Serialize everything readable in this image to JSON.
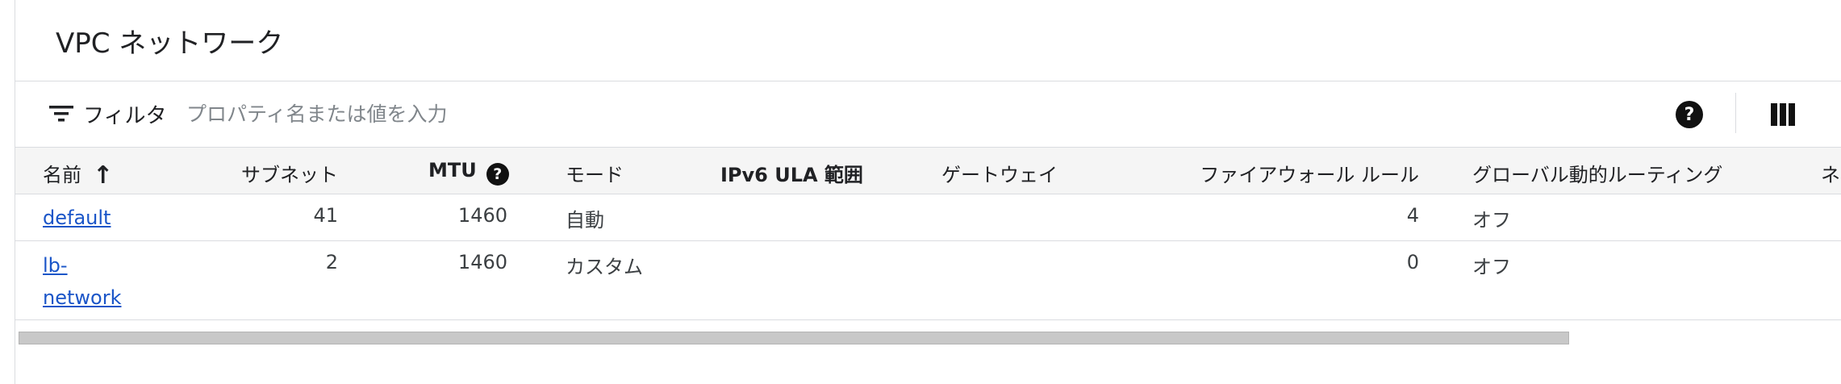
{
  "page": {
    "title": "VPC ネットワーク"
  },
  "filter": {
    "label": "フィルタ",
    "placeholder": "プロパティ名または値を入力",
    "icons": {
      "filter": "filter-lines-icon",
      "help": "help-circle-icon",
      "columns": "column-display-icon"
    }
  },
  "table": {
    "columns": {
      "name": "名前",
      "subnets": "サブネット",
      "mtu": "MTU",
      "mode": "モード",
      "ipv6": "IPv6 ULA 範囲",
      "gateway": "ゲートウェイ",
      "firewall": "ファイアウォール ルール",
      "routing": "グローバル動的ルーティング",
      "cut": "ネ"
    },
    "rows": [
      {
        "name": "default",
        "subnets": "41",
        "mtu": "1460",
        "mode": "自動",
        "ipv6": "",
        "gateway": "",
        "firewall": "4",
        "routing": "オフ"
      },
      {
        "name_line1": "lb-",
        "name_line2": "network",
        "subnets": "2",
        "mtu": "1460",
        "mode": "カスタム",
        "ipv6": "",
        "gateway": "",
        "firewall": "0",
        "routing": "オフ"
      }
    ]
  },
  "colors": {
    "link": "#1a55c8",
    "header_bg": "#f5f5f5",
    "divider": "#dadce0"
  }
}
